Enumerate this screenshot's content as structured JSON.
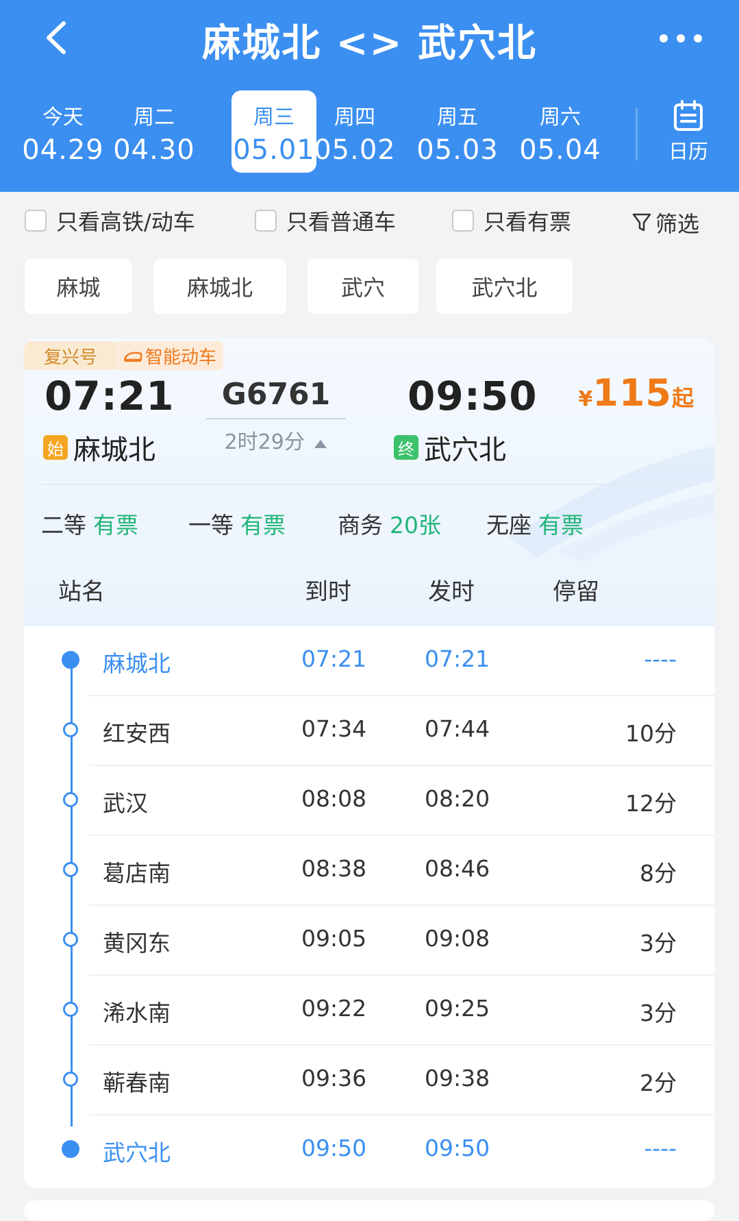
{
  "header": {
    "title": "麻城北 <> 武穴北",
    "calendar_label": "日历"
  },
  "dates": [
    {
      "weekday": "今天",
      "date": "04.29"
    },
    {
      "weekday": "周二",
      "date": "04.30"
    },
    {
      "weekday": "周三",
      "date": "05.01"
    },
    {
      "weekday": "周四",
      "date": "05.02"
    },
    {
      "weekday": "周五",
      "date": "05.03"
    },
    {
      "weekday": "周六",
      "date": "05.04"
    }
  ],
  "filters": {
    "high_speed": "只看高铁/动车",
    "normal": "只看普通车",
    "available": "只看有票",
    "filter_label": "筛选"
  },
  "stations": [
    "麻城",
    "麻城北",
    "武穴",
    "武穴北"
  ],
  "train": {
    "badge_type": "复兴号",
    "badge_smart": "智能动车",
    "dep_time": "07:21",
    "arr_time": "09:50",
    "number": "G6761",
    "duration": "2时29分",
    "dep_station": "麻城北",
    "arr_station": "武穴北",
    "dep_tag": "始",
    "arr_tag": "终",
    "price_currency": "¥",
    "price_amount": "115",
    "price_suffix": "起",
    "seats": [
      {
        "class": "二等",
        "status": "有票"
      },
      {
        "class": "一等",
        "status": "有票"
      },
      {
        "class": "商务",
        "status": "20张"
      },
      {
        "class": "无座",
        "status": "有票"
      }
    ]
  },
  "table": {
    "headers": {
      "name": "站名",
      "arrive": "到时",
      "depart": "发时",
      "stop": "停留"
    },
    "rows": [
      {
        "name": "麻城北",
        "arrive": "07:21",
        "depart": "07:21",
        "stop": "----"
      },
      {
        "name": "红安西",
        "arrive": "07:34",
        "depart": "07:44",
        "stop": "10分"
      },
      {
        "name": "武汉",
        "arrive": "08:08",
        "depart": "08:20",
        "stop": "12分"
      },
      {
        "name": "葛店南",
        "arrive": "08:38",
        "depart": "08:46",
        "stop": "8分"
      },
      {
        "name": "黄冈东",
        "arrive": "09:05",
        "depart": "09:08",
        "stop": "3分"
      },
      {
        "name": "浠水南",
        "arrive": "09:22",
        "depart": "09:25",
        "stop": "3分"
      },
      {
        "name": "蕲春南",
        "arrive": "09:36",
        "depart": "09:38",
        "stop": "2分"
      },
      {
        "name": "武穴北",
        "arrive": "09:50",
        "depart": "09:50",
        "stop": "----"
      }
    ]
  },
  "colors": {
    "header_bg": "#3b8ff0",
    "price": "#f07a18",
    "available": "#23b57a",
    "timeline": "#3b8ff0"
  },
  "icons": {
    "back": "chevron-left-icon",
    "more": "more-icon",
    "calendar": "calendar-icon",
    "filter": "funnel-icon"
  }
}
